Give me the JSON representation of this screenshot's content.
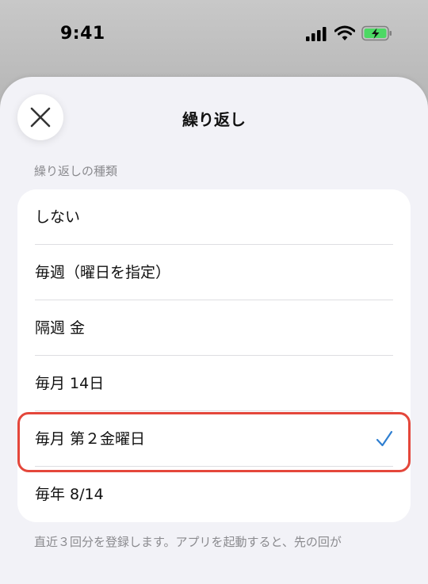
{
  "status_bar": {
    "time": "9:41",
    "signal_icon": "cellular-signal-icon",
    "wifi_icon": "wifi-icon",
    "battery_icon": "battery-charging-icon",
    "battery_color": "#4cd964"
  },
  "sheet": {
    "title": "繰り返し",
    "close_icon": "close-icon",
    "section_header": "繰り返しの種類",
    "options": [
      {
        "label": "しない",
        "selected": false
      },
      {
        "label": "毎週（曜日を指定）",
        "selected": false
      },
      {
        "label": "隔週 金",
        "selected": false
      },
      {
        "label": "毎月 14日",
        "selected": false
      },
      {
        "label": "毎月 第２金曜日",
        "selected": true
      },
      {
        "label": "毎年 8/14",
        "selected": false
      }
    ],
    "check_icon": "checkmark-icon",
    "accent_color": "#2f7fd1",
    "highlight_color": "#e4473b",
    "footnote": "直近３回分を登録します。アプリを起動すると、先の回が"
  }
}
